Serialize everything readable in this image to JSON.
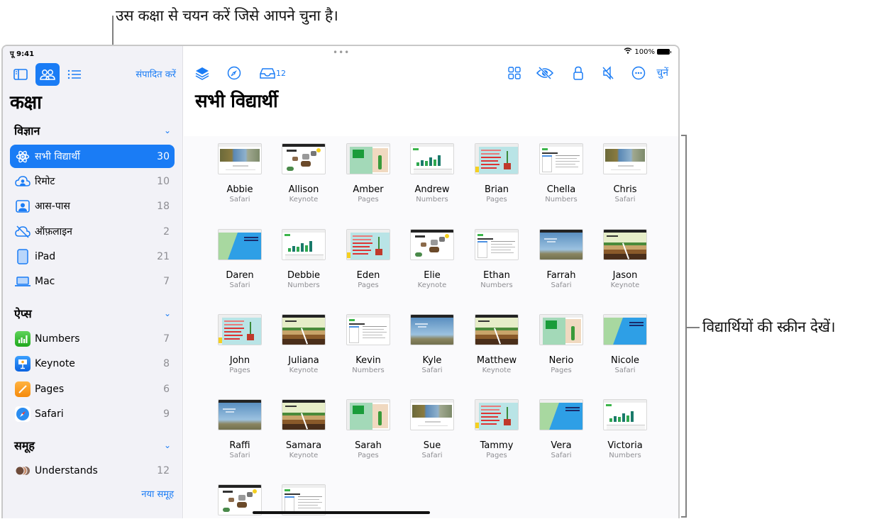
{
  "callouts": {
    "top": "उस कक्षा से चयन करें जिसे आपने चुना है।",
    "right": "विद्यार्थियों की स्क्रीन देखें।"
  },
  "status_bar": {
    "time": "पू 9:41",
    "battery": "100%"
  },
  "sidebar": {
    "edit_label": "संपादित करें",
    "title": "कक्षा",
    "sections": [
      {
        "header": "विज्ञान",
        "items": [
          {
            "label": "सभी विद्यार्थी",
            "count": "30",
            "icon": "atom-icon",
            "selected": true
          },
          {
            "label": "रिमोट",
            "count": "10",
            "icon": "cloud-person-icon"
          },
          {
            "label": "आस-पास",
            "count": "18",
            "icon": "person-square-icon"
          },
          {
            "label": "ऑफ़लाइन",
            "count": "2",
            "icon": "cloud-slash-icon"
          },
          {
            "label": "iPad",
            "count": "21",
            "icon": "ipad-icon"
          },
          {
            "label": "Mac",
            "count": "7",
            "icon": "laptop-icon"
          }
        ]
      },
      {
        "header": "ऐप्स",
        "items": [
          {
            "label": "Numbers",
            "count": "7",
            "icon": "numbers-app-icon"
          },
          {
            "label": "Keynote",
            "count": "8",
            "icon": "keynote-app-icon"
          },
          {
            "label": "Pages",
            "count": "6",
            "icon": "pages-app-icon"
          },
          {
            "label": "Safari",
            "count": "9",
            "icon": "safari-app-icon"
          }
        ]
      },
      {
        "header": "समूह",
        "items": [
          {
            "label": "Understands",
            "count": "12",
            "icon": "group-avatars-icon"
          }
        ]
      }
    ],
    "new_group_label": "नया समूह"
  },
  "main": {
    "title": "सभी विद्यार्थी",
    "inbox_count": "12",
    "choose_label": "चुनें",
    "students": [
      {
        "name": "Abbie",
        "app": "Safari",
        "thumb": "safari-forest"
      },
      {
        "name": "Allison",
        "app": "Keynote",
        "thumb": "keynote-foodweb"
      },
      {
        "name": "Amber",
        "app": "Pages",
        "thumb": "pages-cactus"
      },
      {
        "name": "Andrew",
        "app": "Numbers",
        "thumb": "numbers-chart"
      },
      {
        "name": "Brian",
        "app": "Pages",
        "thumb": "pages-plant"
      },
      {
        "name": "Chella",
        "app": "Numbers",
        "thumb": "numbers-doc"
      },
      {
        "name": "Chris",
        "app": "Safari",
        "thumb": "safari-forest"
      },
      {
        "name": "Daren",
        "app": "Safari",
        "thumb": "safari-reef"
      },
      {
        "name": "Debbie",
        "app": "Numbers",
        "thumb": "numbers-chart"
      },
      {
        "name": "Eden",
        "app": "Pages",
        "thumb": "pages-plant"
      },
      {
        "name": "Elie",
        "app": "Keynote",
        "thumb": "keynote-foodweb"
      },
      {
        "name": "Ethan",
        "app": "Numbers",
        "thumb": "numbers-doc"
      },
      {
        "name": "Farrah",
        "app": "Safari",
        "thumb": "safari-energy"
      },
      {
        "name": "Jason",
        "app": "Keynote",
        "thumb": "keynote-earthquake"
      },
      {
        "name": "John",
        "app": "Pages",
        "thumb": "pages-plant"
      },
      {
        "name": "Juliana",
        "app": "Keynote",
        "thumb": "keynote-earthquake"
      },
      {
        "name": "Kevin",
        "app": "Numbers",
        "thumb": "numbers-doc"
      },
      {
        "name": "Kyle",
        "app": "Safari",
        "thumb": "safari-energy"
      },
      {
        "name": "Matthew",
        "app": "Keynote",
        "thumb": "keynote-earthquake"
      },
      {
        "name": "Nerio",
        "app": "Pages",
        "thumb": "pages-cactus"
      },
      {
        "name": "Nicole",
        "app": "Safari",
        "thumb": "safari-reef"
      },
      {
        "name": "Raffi",
        "app": "Safari",
        "thumb": "safari-energy"
      },
      {
        "name": "Samara",
        "app": "Keynote",
        "thumb": "keynote-earthquake"
      },
      {
        "name": "Sarah",
        "app": "Pages",
        "thumb": "pages-cactus"
      },
      {
        "name": "Sue",
        "app": "Safari",
        "thumb": "safari-forest"
      },
      {
        "name": "Tammy",
        "app": "Pages",
        "thumb": "pages-plant"
      },
      {
        "name": "Vera",
        "app": "Safari",
        "thumb": "safari-reef"
      },
      {
        "name": "Victoria",
        "app": "Numbers",
        "thumb": "numbers-chart"
      },
      {
        "name": "",
        "app": "",
        "thumb": "keynote-foodweb"
      },
      {
        "name": "",
        "app": "",
        "thumb": "numbers-doc"
      }
    ]
  },
  "colors": {
    "accent": "#1a7cf5",
    "sidebar_bg": "#f2f2f7"
  }
}
